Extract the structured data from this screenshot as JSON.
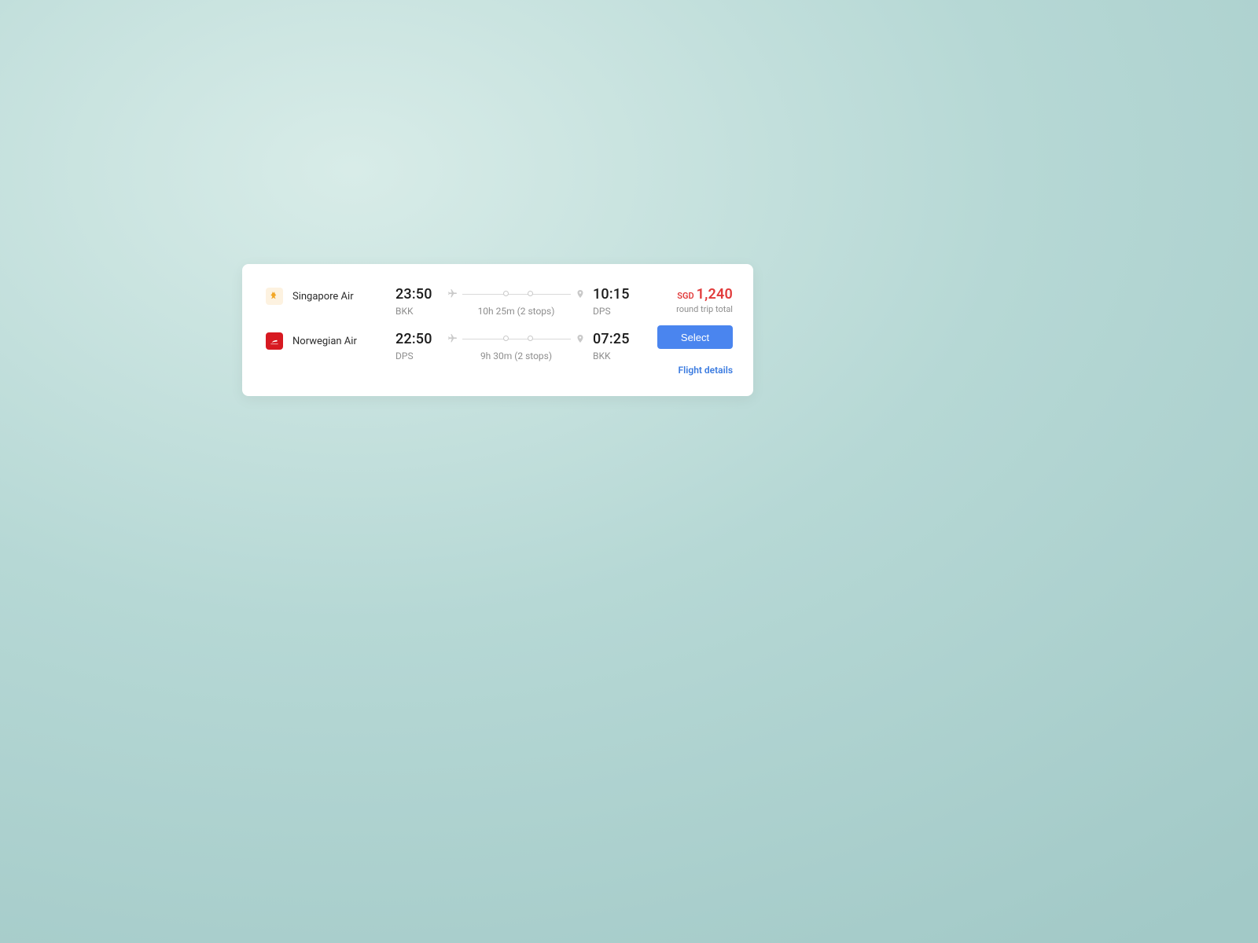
{
  "card": {
    "legs": [
      {
        "airline": "Singapore Air",
        "logo_variant": "sq",
        "logo_glyph": "✦",
        "depart_time": "23:50",
        "depart_code": "BKK",
        "arrive_time": "10:15",
        "arrive_code": "DPS",
        "duration": "10h 25m (2 stops)"
      },
      {
        "airline": "Norwegian Air",
        "logo_variant": "ek",
        "logo_glyph": "✈",
        "depart_time": "22:50",
        "depart_code": "DPS",
        "arrive_time": "07:25",
        "arrive_code": "BKK",
        "duration": "9h 30m (2 stops)"
      }
    ],
    "price": {
      "currency": "SGD",
      "amount": "1,240",
      "sub": "round trip total"
    },
    "select_label": "Select",
    "details_label": "Flight details"
  }
}
